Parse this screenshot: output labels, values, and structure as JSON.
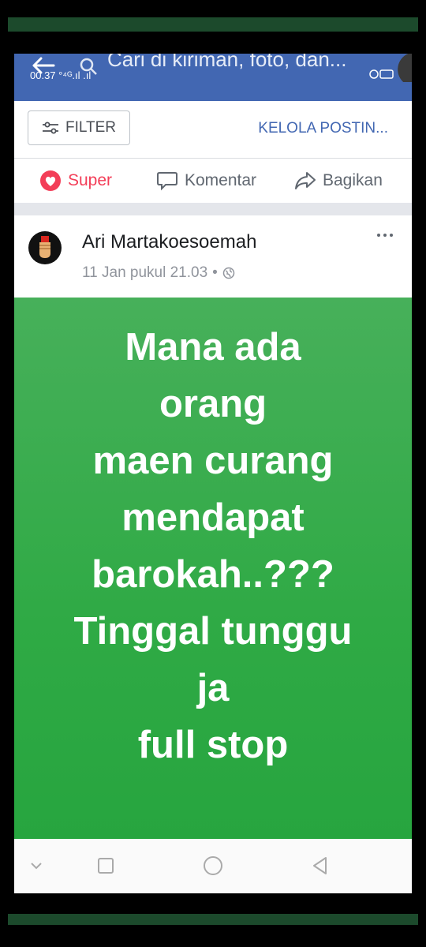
{
  "status_bar": {
    "time": "00.37"
  },
  "search": {
    "placeholder": "Cari di kiriman, foto, dan..."
  },
  "filter_bar": {
    "filter_label": "FILTER",
    "manage_label": "KELOLA POSTIN..."
  },
  "actions": {
    "react_label": "Super",
    "comment_label": "Komentar",
    "share_label": "Bagikan"
  },
  "post": {
    "author": "Ari Martakoesoemah",
    "timestamp": "11 Jan pukul 21.03",
    "separator": "•",
    "audience_icon": "globe-icon",
    "lines": [
      "Mana ada",
      "orang",
      "maen curang",
      "mendapat",
      "barokah..???",
      "Tinggal tunggu",
      "ja",
      "full stop"
    ],
    "background_color": "#32a948"
  },
  "colors": {
    "facebook_blue": "#4267b2",
    "super_red": "#f33e58",
    "post_green": "#32a948"
  },
  "icons": [
    "back-arrow-icon",
    "search-icon",
    "filter-sliders-icon",
    "heart-icon",
    "comment-bubble-icon",
    "share-arrow-icon",
    "more-dots-icon",
    "globe-icon",
    "nav-back-icon",
    "nav-home-icon",
    "nav-recents-icon",
    "nav-collapse-icon"
  ]
}
